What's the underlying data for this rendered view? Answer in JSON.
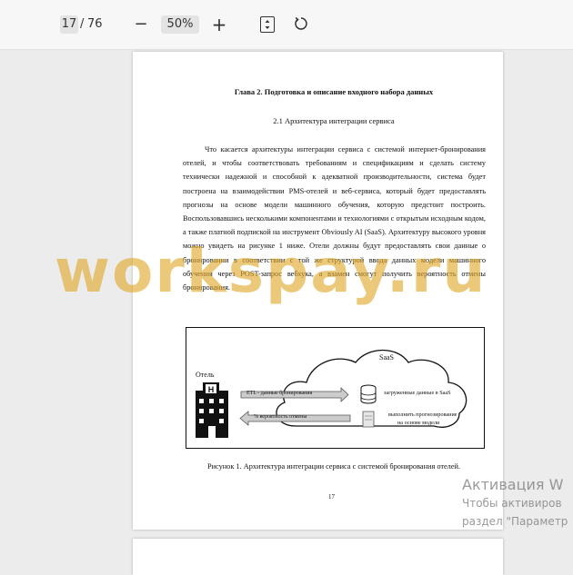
{
  "toolbar": {
    "page_current": "17",
    "page_separator": "/",
    "page_total": "76",
    "zoom_out_icon": "−",
    "zoom_value": "50%",
    "zoom_in_icon": "+"
  },
  "document": {
    "chapter_title": "Глава 2. Подготовка и описание входного набора данных",
    "section_title": "2.1 Архитектура интеграции сервиса",
    "paragraph": "Что касается архитектуры интеграции сервиса с системой интернет-бронирования отелей, и чтобы соответствовать требованиям и спецификациям и сделать систему технически надежной и способной к адекватной производительности, система будет построена на взаимодействии PMS-отелей и веб-сервиса, который будет предоставлять прогнозы на основе модели машинного обучения, которую предстоит построить. Воспользовавшись несколькими компонентами и технологиями с открытым исходным кодом, а также платной подпиской на инструмент Obviously AI (SaaS). Архитектуру высокого уровня можно увидеть на рисунке 1 ниже. Отели должны будут предоставлять свои данные о бронировании в соответствии с той же структурой ввода данных модели машинного обучения через POST-запрос вебхука, а взамен смогут получить вероятность отмены бронирования.",
    "figure": {
      "saas_label": "SaaS",
      "hotel_label": "Отель",
      "etl_arrow_label": "ETL - данные бронирования",
      "probability_arrow_label": "% вероятность отмены",
      "loaded_data_label": "загруженные данные в SaaS",
      "prediction_label_line1": "выполнить прогнозирование",
      "prediction_label_line2": "на основе модели"
    },
    "caption": "Рисунок 1. Архитектура интеграции сервиса с системой бронирования отелей.",
    "page_number": "17"
  },
  "overlays": {
    "watermark": "workspay.ru",
    "activation_title": "Активация W",
    "activation_line1": "Чтобы активиров",
    "activation_line2": "раздел \"Параметр"
  }
}
